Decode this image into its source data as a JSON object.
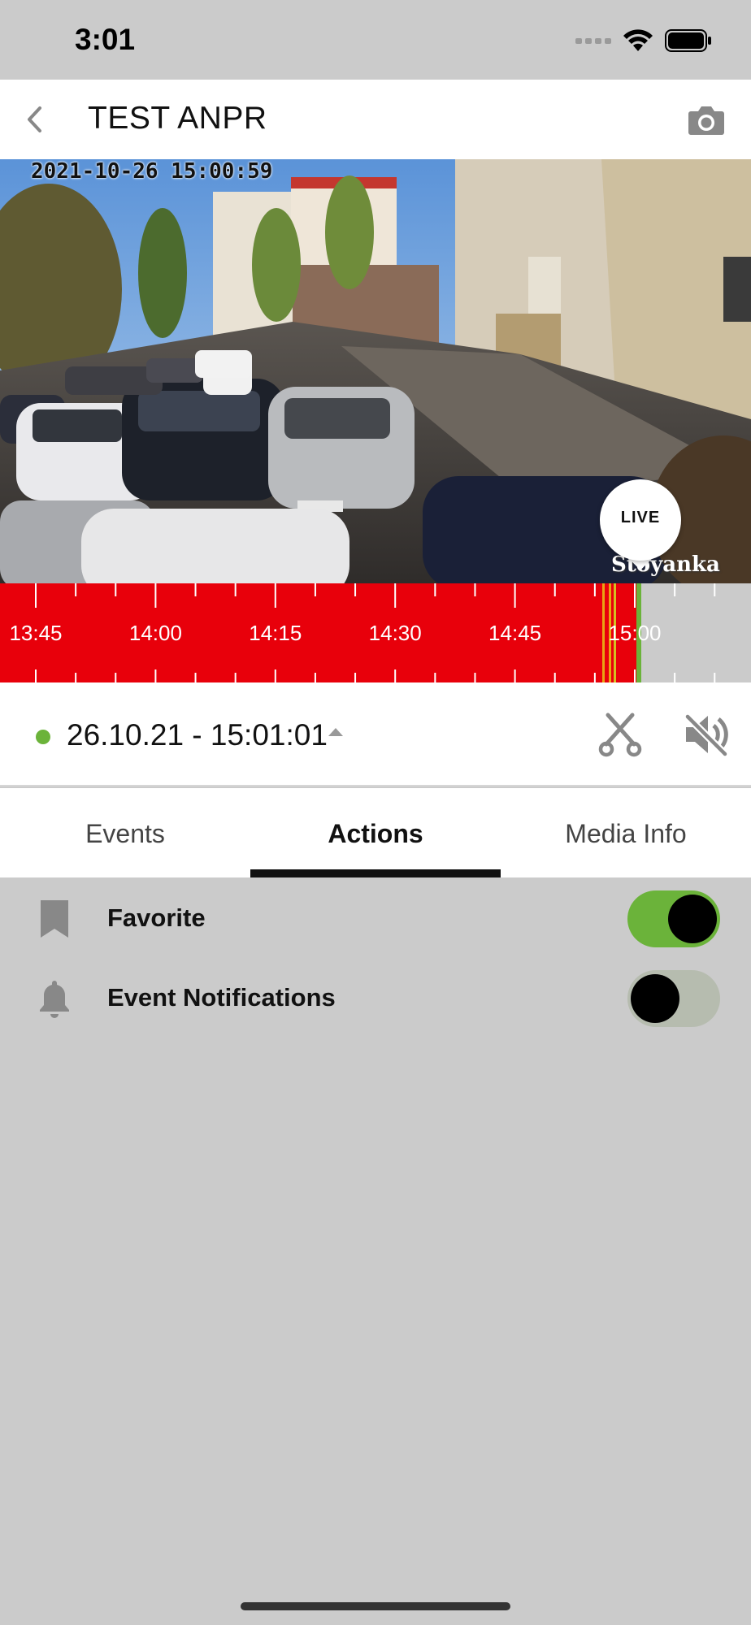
{
  "status_bar": {
    "time": "3:01"
  },
  "header": {
    "title": "TEST ANPR",
    "back_icon": "chevron-left-icon",
    "camera_icon": "camera-icon"
  },
  "video": {
    "osd_timestamp": "2021-10-26 15:00:59",
    "osd_label": "Stoyanka",
    "live_button": "LIVE"
  },
  "timeline": {
    "labels": [
      "13:45",
      "14:00",
      "14:15",
      "14:30",
      "14:45",
      "15:00"
    ],
    "recording_color": "#e8000b",
    "empty_color": "#cbcbcb",
    "playhead_color": "#6bb33a"
  },
  "playback": {
    "datetime": "26.10.21 - 15:01:01",
    "status_color": "#6bb33a",
    "scissors_icon": "scissors-icon",
    "mute_icon": "speaker-muted-icon"
  },
  "tabs": [
    {
      "label": "Events",
      "active": false
    },
    {
      "label": "Actions",
      "active": true
    },
    {
      "label": "Media Info",
      "active": false
    }
  ],
  "actions": [
    {
      "label": "Favorite",
      "icon": "bookmark-icon",
      "enabled": true
    },
    {
      "label": "Event Notifications",
      "icon": "bell-icon",
      "enabled": false
    }
  ],
  "colors": {
    "accent": "#6bb33a",
    "background": "#cbcbcb"
  }
}
